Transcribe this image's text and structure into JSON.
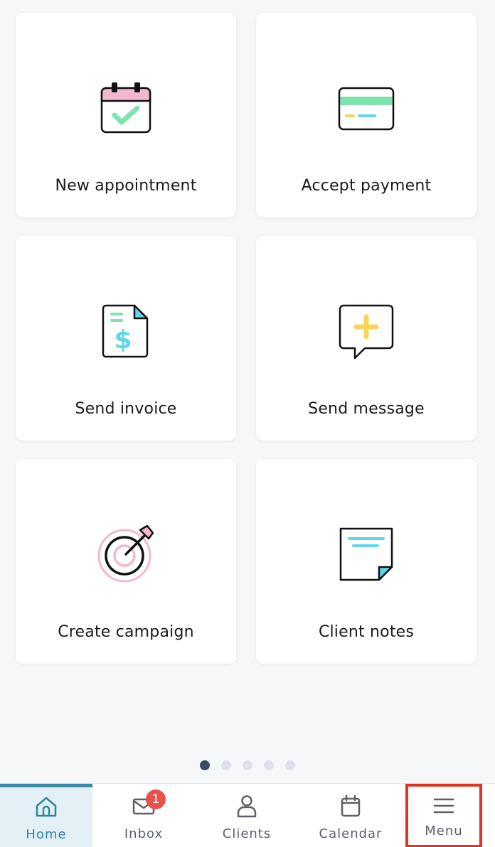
{
  "tiles": [
    {
      "label": "New appointment",
      "icon": "calendar-check-icon"
    },
    {
      "label": "Accept payment",
      "icon": "credit-card-icon"
    },
    {
      "label": "Send invoice",
      "icon": "invoice-dollar-icon"
    },
    {
      "label": "Send message",
      "icon": "message-plus-icon"
    },
    {
      "label": "Create campaign",
      "icon": "target-arrow-icon"
    },
    {
      "label": "Client notes",
      "icon": "sticky-note-icon"
    }
  ],
  "pagination": {
    "total": 5,
    "active_index": 0
  },
  "tabbar": {
    "home": {
      "label": "Home",
      "icon": "home-icon"
    },
    "inbox": {
      "label": "Inbox",
      "icon": "mail-icon",
      "badge": "1"
    },
    "clients": {
      "label": "Clients",
      "icon": "person-icon"
    },
    "calendar": {
      "label": "Calendar",
      "icon": "calendar-icon"
    },
    "menu": {
      "label": "Menu",
      "icon": "hamburger-menu-icon"
    }
  },
  "colors": {
    "accent_teal": "#2f84a3",
    "highlight_border": "#e5321e",
    "badge_red": "#e5534b",
    "pink": "#f2b8cf",
    "green": "#7ee3ad",
    "cyan": "#5fd6ec",
    "yellow": "#f6d55c"
  }
}
